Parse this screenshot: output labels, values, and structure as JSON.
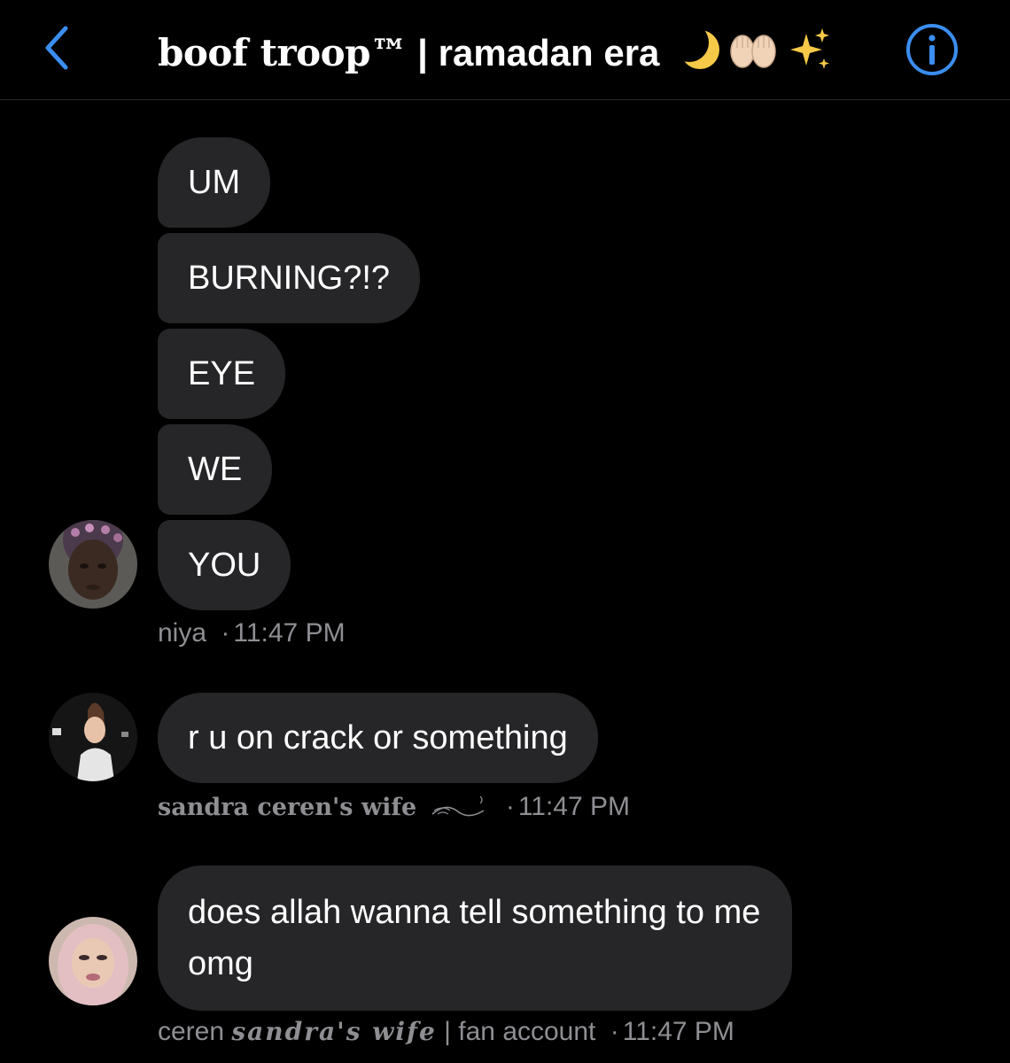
{
  "header": {
    "title_part1": "boof troop™",
    "title_sep": " | ",
    "title_part2": "ramadan era",
    "title_emojis": [
      "crescent-moon",
      "raised-palms",
      "sparkles"
    ],
    "accent_color": "#3b8ef0"
  },
  "messages": [
    {
      "sender": "niya",
      "text": "UM"
    },
    {
      "sender": "niya",
      "text": "BURNING?!?"
    },
    {
      "sender": "niya",
      "text": "EYE"
    },
    {
      "sender": "niya",
      "text": "WE"
    },
    {
      "sender": "niya",
      "text": "YOU"
    },
    {
      "sender": "sandra ceren's wife",
      "text": "r u on crack or something"
    },
    {
      "sender": "ceren",
      "text": "does allah wanna tell something to me omg"
    }
  ],
  "meta": {
    "niya": {
      "name": "niya",
      "dot": "·",
      "time": "11:47 PM"
    },
    "sandra": {
      "name": "sandra ceren's wife",
      "dot": "·",
      "time": "11:47 PM"
    },
    "ceren": {
      "name": "ceren ",
      "name_italic": "sandra's wife",
      "suffix": " | fan account ",
      "dot": "·",
      "time": "11:47 PM"
    }
  },
  "colors": {
    "background": "#000000",
    "bubble": "#262628",
    "meta_text": "#8e8e93"
  }
}
